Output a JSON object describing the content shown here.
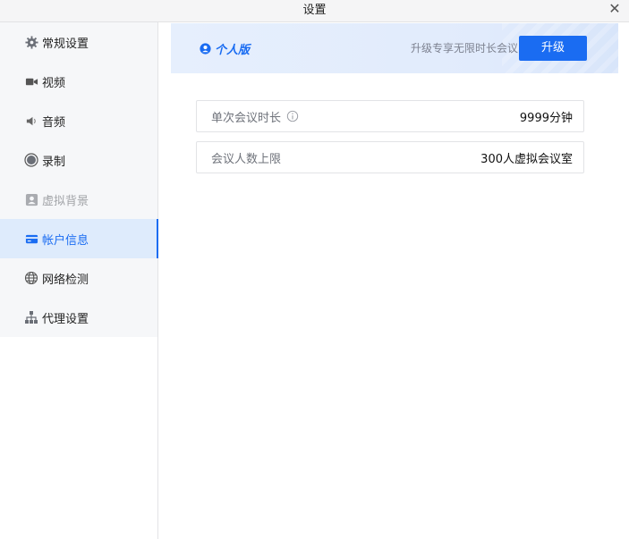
{
  "window": {
    "title": "设置",
    "close_glyph": "✕"
  },
  "sidebar": {
    "items": [
      {
        "label": "常规设置",
        "icon": "gear-icon"
      },
      {
        "label": "视频",
        "icon": "video-camera-icon"
      },
      {
        "label": "音频",
        "icon": "speaker-icon"
      },
      {
        "label": "录制",
        "icon": "record-icon"
      },
      {
        "label": "虚拟背景",
        "icon": "portrait-icon",
        "state": "disabled"
      },
      {
        "label": "帐户信息",
        "icon": "card-icon",
        "state": "active"
      },
      {
        "label": "网络检测",
        "icon": "globe-icon"
      },
      {
        "label": "代理设置",
        "icon": "network-tree-icon"
      }
    ]
  },
  "account": {
    "edition_label": "个人版",
    "upgrade_tip": "升级专享无限时长会议",
    "upgrade_button": "升级",
    "rows": [
      {
        "key": "单次会议时长",
        "value": "9999分钟",
        "has_info_icon": true
      },
      {
        "key": "会议人数上限",
        "value": "300人虚拟会议室"
      }
    ]
  },
  "colors": {
    "accent": "#1a6cf2",
    "active_bg": "#deebfc",
    "sidebar_bg": "#f6f7f9",
    "banner_bg": "#e4edfc"
  }
}
